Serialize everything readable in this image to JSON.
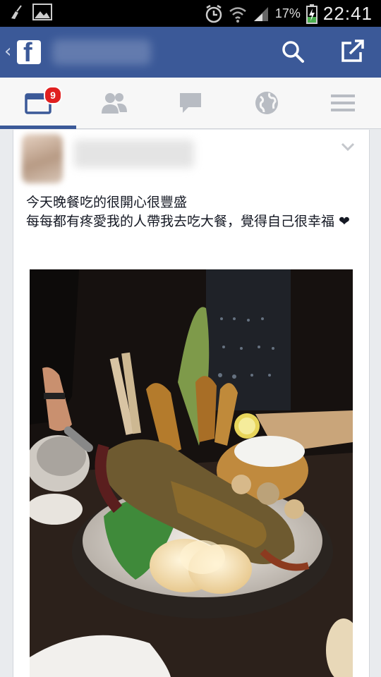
{
  "status_bar": {
    "battery_percent": "17%",
    "time": "22:41"
  },
  "header": {
    "back_glyph": "‹",
    "logo_letter": "f"
  },
  "nav": {
    "notification_count": "9",
    "tabs": [
      "news-feed",
      "friends",
      "messages",
      "notifications",
      "menu"
    ]
  },
  "post": {
    "text_line1": "今天晚餐吃的很開心很豐盛",
    "text_line2": "每每都有疼愛我的人帶我去吃大餐，覺得自己很幸福 ❤"
  },
  "colors": {
    "facebook_blue": "#3b5998",
    "badge_red": "#e02020"
  }
}
